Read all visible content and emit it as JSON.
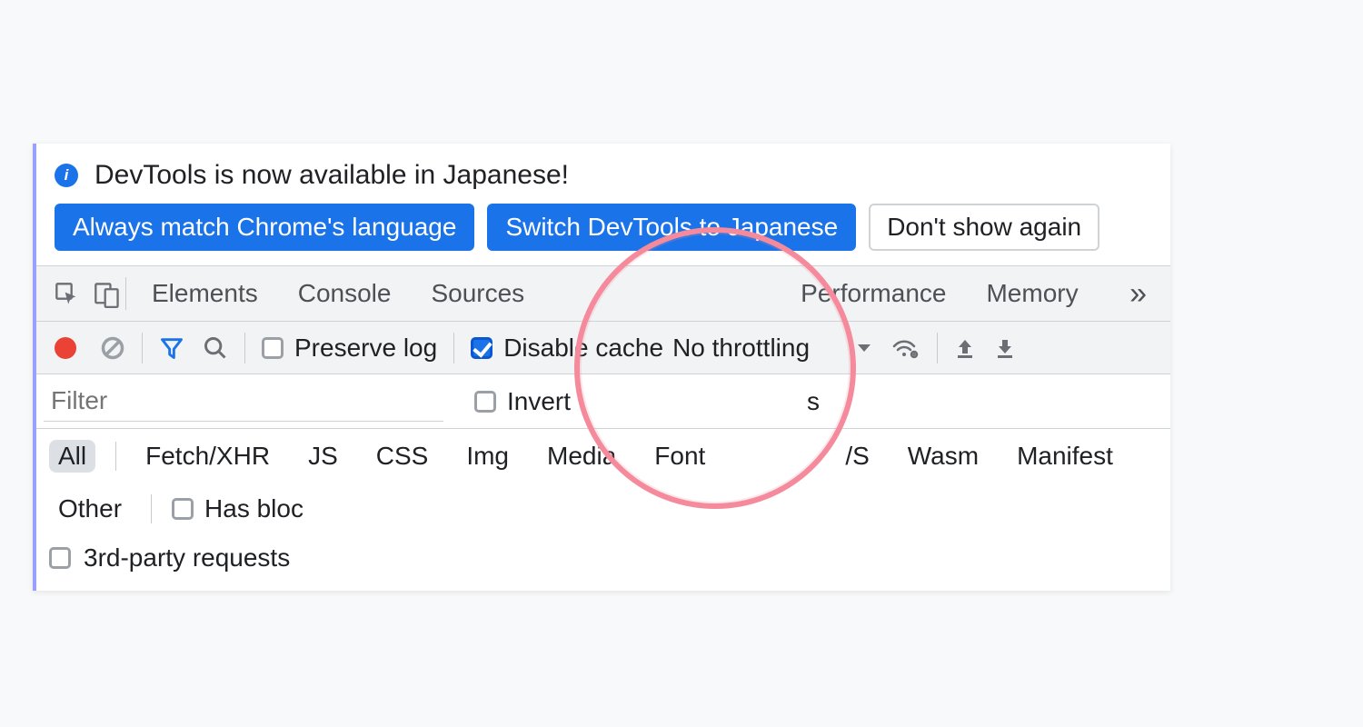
{
  "info": {
    "message": "DevTools is now available in Japanese!",
    "buttons": {
      "match": "Always match Chrome's language",
      "switch": "Switch DevTools to Japanese",
      "dismiss": "Don't show again"
    }
  },
  "tabs": {
    "elements": "Elements",
    "console": "Console",
    "sources": "Sources",
    "performance": "Performance",
    "memory": "Memory"
  },
  "toolbar": {
    "preserve_log": "Preserve log",
    "disable_cache": "Disable cache",
    "throttling": "No throttling"
  },
  "filter": {
    "placeholder": "Filter",
    "invert": "Invert",
    "hidden_option_partial": "s"
  },
  "types": {
    "all": "All",
    "fetch": "Fetch/XHR",
    "js": "JS",
    "css": "CSS",
    "img": "Img",
    "media": "Media",
    "font": "Font",
    "ws_partial": "/S",
    "wasm": "Wasm",
    "manifest": "Manifest",
    "other": "Other",
    "has_blocked_partial": "Has bloc"
  },
  "third_party": "3rd-party requests"
}
